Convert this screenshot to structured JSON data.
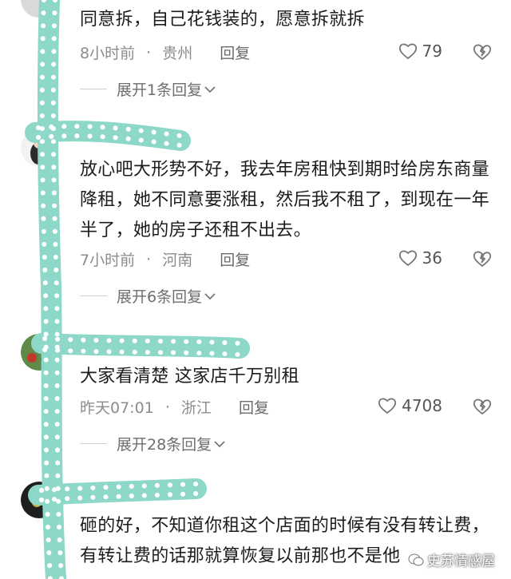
{
  "comments": [
    {
      "text": "同意拆，自己花钱装的，愿意拆就拆",
      "time": "8小时前",
      "location": "贵州",
      "reply_label": "回复",
      "likes": "79",
      "expand_label": "展开1条回复"
    },
    {
      "text": "放心吧大形势不好，我去年房租快到期时给房东商量降租，她不同意要涨租，然后我不租了，到现在一年半了，她的房子还租不出去。",
      "time": "7小时前",
      "location": "河南",
      "reply_label": "回复",
      "likes": "36",
      "expand_label": "展开6条回复"
    },
    {
      "text": "大家看清楚 这家店千万别租",
      "time": "昨天07:01",
      "location": "浙江",
      "reply_label": "回复",
      "likes": "4708",
      "expand_label": "展开28条回复"
    },
    {
      "text": "砸的好，不知道你租这个店面的时候有没有转让费，有转让费的话那就算恢复以前那也不是他"
    }
  ],
  "separator": "·",
  "watermark": "史苏情感屋",
  "colors": {
    "doodle": "#8dd8c8",
    "meta": "#8c8c8c",
    "text": "#1c1c1c"
  }
}
